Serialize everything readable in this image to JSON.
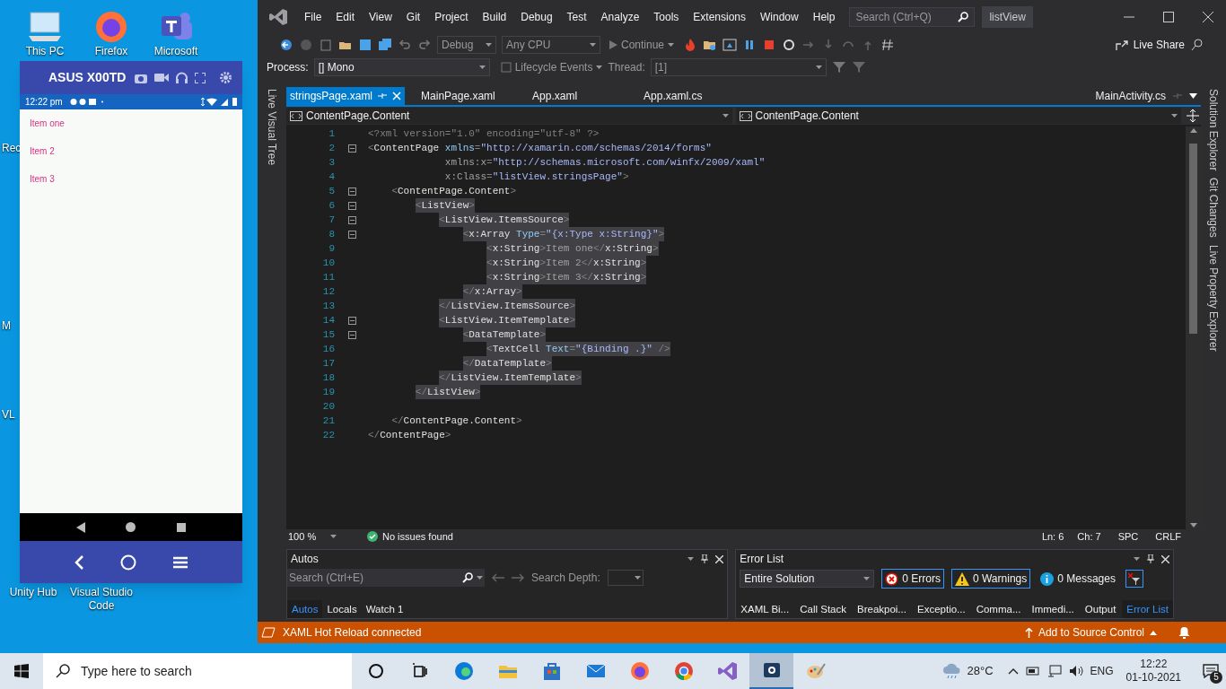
{
  "desktop": {
    "icons": [
      {
        "label": "This PC",
        "kind": "pc"
      },
      {
        "label": "Firefox",
        "kind": "firefox"
      },
      {
        "label": "Microsoft",
        "kind": "teams"
      },
      {
        "label": "Rec"
      },
      {
        "label": "M"
      },
      {
        "label": "VL"
      },
      {
        "label": "Unity Hub"
      },
      {
        "label": "Visual Studio Code"
      }
    ]
  },
  "emulator": {
    "title": "ASUS X00TD",
    "status_time": "12:22 pm",
    "items": [
      "Item one",
      "Item 2",
      "Item 3"
    ]
  },
  "vs": {
    "menu": [
      "File",
      "Edit",
      "View",
      "Git",
      "Project",
      "Build",
      "Debug",
      "Test",
      "Analyze",
      "Tools",
      "Extensions",
      "Window",
      "Help"
    ],
    "search_placeholder": "Search (Ctrl+Q)",
    "solution": "listView",
    "toolbar": {
      "configuration": "Debug",
      "platform": "Any CPU",
      "continue": "Continue",
      "live_share": "Live Share"
    },
    "process": {
      "label": "Process:",
      "value": "[] Mono",
      "lifecycle": "Lifecycle Events",
      "thread_label": "Thread:",
      "thread": "[1]"
    },
    "tabs": [
      {
        "label": "stringsPage.xaml",
        "selected": true
      },
      {
        "label": "MainPage.xaml",
        "selected": false
      },
      {
        "label": "App.xaml",
        "selected": false
      },
      {
        "label": "App.xaml.cs",
        "selected": false
      }
    ],
    "right_tab": "MainActivity.cs",
    "nav": [
      "ContentPage.Content",
      "ContentPage.Content"
    ],
    "left_tool_windows": [
      "Live Visual Tree"
    ],
    "right_tool_windows": [
      "Solution Explorer",
      "Git Changes",
      "Live Property Explorer"
    ],
    "editor": {
      "lines": [
        {
          "number": "1",
          "text": "<?xml version=\"1.0\" encoding=\"utf-8\" ?>",
          "foldable": false,
          "highlighted": false
        },
        {
          "number": "2",
          "text": "<ContentPage xmlns=\"http://xamarin.com/schemas/2014/forms\"",
          "foldable": true,
          "highlighted": false
        },
        {
          "number": "3",
          "text": "             xmlns:x=\"http://schemas.microsoft.com/winfx/2009/xaml\"",
          "foldable": false,
          "highlighted": false
        },
        {
          "number": "4",
          "text": "             x:Class=\"listView.stringsPage\">",
          "foldable": false,
          "highlighted": false
        },
        {
          "number": "5",
          "text": "    <ContentPage.Content>",
          "foldable": true,
          "highlighted": false
        },
        {
          "number": "6",
          "text": "        <ListView>",
          "foldable": true,
          "highlighted": true
        },
        {
          "number": "7",
          "text": "            <ListView.ItemsSource>",
          "foldable": true,
          "highlighted": true
        },
        {
          "number": "8",
          "text": "                <x:Array Type=\"{x:Type x:String}\">",
          "foldable": true,
          "highlighted": true
        },
        {
          "number": "9",
          "text": "                    <x:String>Item one</x:String>",
          "foldable": false,
          "highlighted": true
        },
        {
          "number": "10",
          "text": "                    <x:String>Item 2</x:String>",
          "foldable": false,
          "highlighted": true
        },
        {
          "number": "11",
          "text": "                    <x:String>Item 3</x:String>",
          "foldable": false,
          "highlighted": true
        },
        {
          "number": "12",
          "text": "                </x:Array>",
          "foldable": false,
          "highlighted": true
        },
        {
          "number": "13",
          "text": "            </ListView.ItemsSource>",
          "foldable": false,
          "highlighted": true
        },
        {
          "number": "14",
          "text": "            <ListView.ItemTemplate>",
          "foldable": true,
          "highlighted": true
        },
        {
          "number": "15",
          "text": "                <DataTemplate>",
          "foldable": true,
          "highlighted": true
        },
        {
          "number": "16",
          "text": "                    <TextCell Text=\"{Binding .}\" />",
          "foldable": false,
          "highlighted": true
        },
        {
          "number": "17",
          "text": "                </DataTemplate>",
          "foldable": false,
          "highlighted": true
        },
        {
          "number": "18",
          "text": "            </ListView.ItemTemplate>",
          "foldable": false,
          "highlighted": true
        },
        {
          "number": "19",
          "text": "        </ListView>",
          "foldable": false,
          "highlighted": true
        },
        {
          "number": "20",
          "foldable": false
        },
        {
          "number": "21",
          "text": "    </ContentPage.Content>",
          "foldable": false,
          "highlighted": false
        },
        {
          "number": "22",
          "text": "</ContentPage>",
          "foldable": false,
          "highlighted": false
        }
      ]
    },
    "editor_status": {
      "zoom": "100 %",
      "issues": "No issues found",
      "line": "Ln: 6",
      "column": "Ch: 7",
      "spacing": "SPC",
      "line_ending": "CRLF"
    },
    "autos": {
      "title": "Autos",
      "search_placeholder": "Search (Ctrl+E)",
      "depth_label": "Search Depth:",
      "tabs": [
        {
          "label": "Autos",
          "selected": true
        },
        {
          "label": "Locals",
          "selected": false
        },
        {
          "label": "Watch 1",
          "selected": false
        }
      ]
    },
    "error_list": {
      "title": "Error List",
      "scope": "Entire Solution",
      "errors": "0 Errors",
      "warnings": "0 Warnings",
      "messages": "0 Messages",
      "tabs": [
        {
          "label": "XAML Bi...",
          "selected": false
        },
        {
          "label": "Call Stack",
          "selected": false
        },
        {
          "label": "Breakpoi...",
          "selected": false
        },
        {
          "label": "Exceptio...",
          "selected": false
        },
        {
          "label": "Comma...",
          "selected": false
        },
        {
          "label": "Immedi...",
          "selected": false
        },
        {
          "label": "Output",
          "selected": false
        },
        {
          "label": "Error List",
          "selected": true
        }
      ]
    },
    "status_bar": {
      "message": "XAML Hot Reload connected",
      "source_control": "Add to Source Control"
    }
  },
  "taskbar": {
    "search_placeholder": "Type here to search",
    "apps": [
      {
        "kind": "cortana",
        "selected": false
      },
      {
        "kind": "taskview",
        "selected": false
      },
      {
        "kind": "edge",
        "selected": false
      },
      {
        "kind": "explorer",
        "selected": false
      },
      {
        "kind": "store",
        "selected": false
      },
      {
        "kind": "mail",
        "selected": false
      },
      {
        "kind": "firefox",
        "selected": false
      },
      {
        "kind": "chrome",
        "selected": false
      },
      {
        "kind": "vs",
        "selected": false
      },
      {
        "kind": "app",
        "selected": true
      },
      {
        "kind": "paint",
        "selected": false
      }
    ],
    "temperature": "28°C",
    "language": "ENG",
    "time": "12:22",
    "date": "01-10-2021",
    "notifications": "5"
  }
}
